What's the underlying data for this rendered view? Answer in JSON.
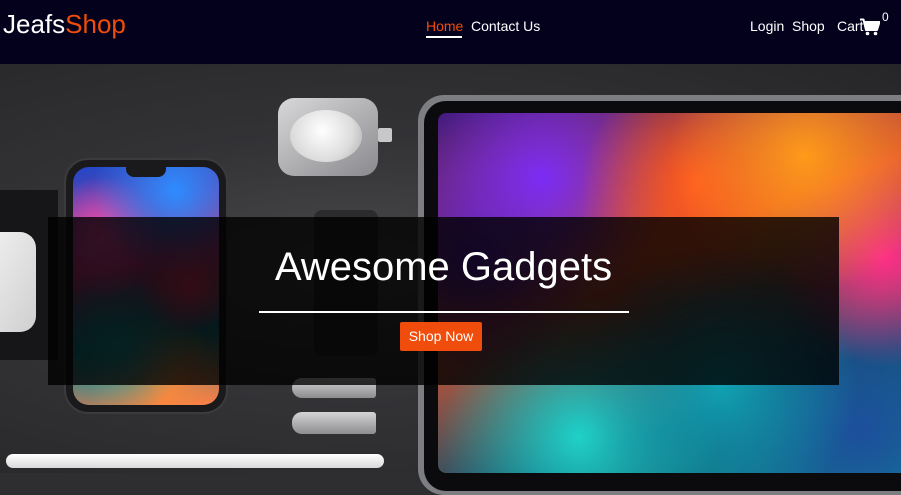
{
  "brand": {
    "part1": "Jeafs",
    "part2": "Shop"
  },
  "nav": {
    "home": "Home",
    "contact": "Contact Us",
    "login": "Login",
    "shop": "Shop",
    "cart": "Cart",
    "cart_count": "0"
  },
  "hero": {
    "title": "Awesome Gadgets",
    "button": "Shop Now"
  },
  "colors": {
    "navbar_bg": "#04011d",
    "accent": "#f04c0b",
    "text": "#ffffff"
  },
  "icons": [
    "cart-icon"
  ]
}
